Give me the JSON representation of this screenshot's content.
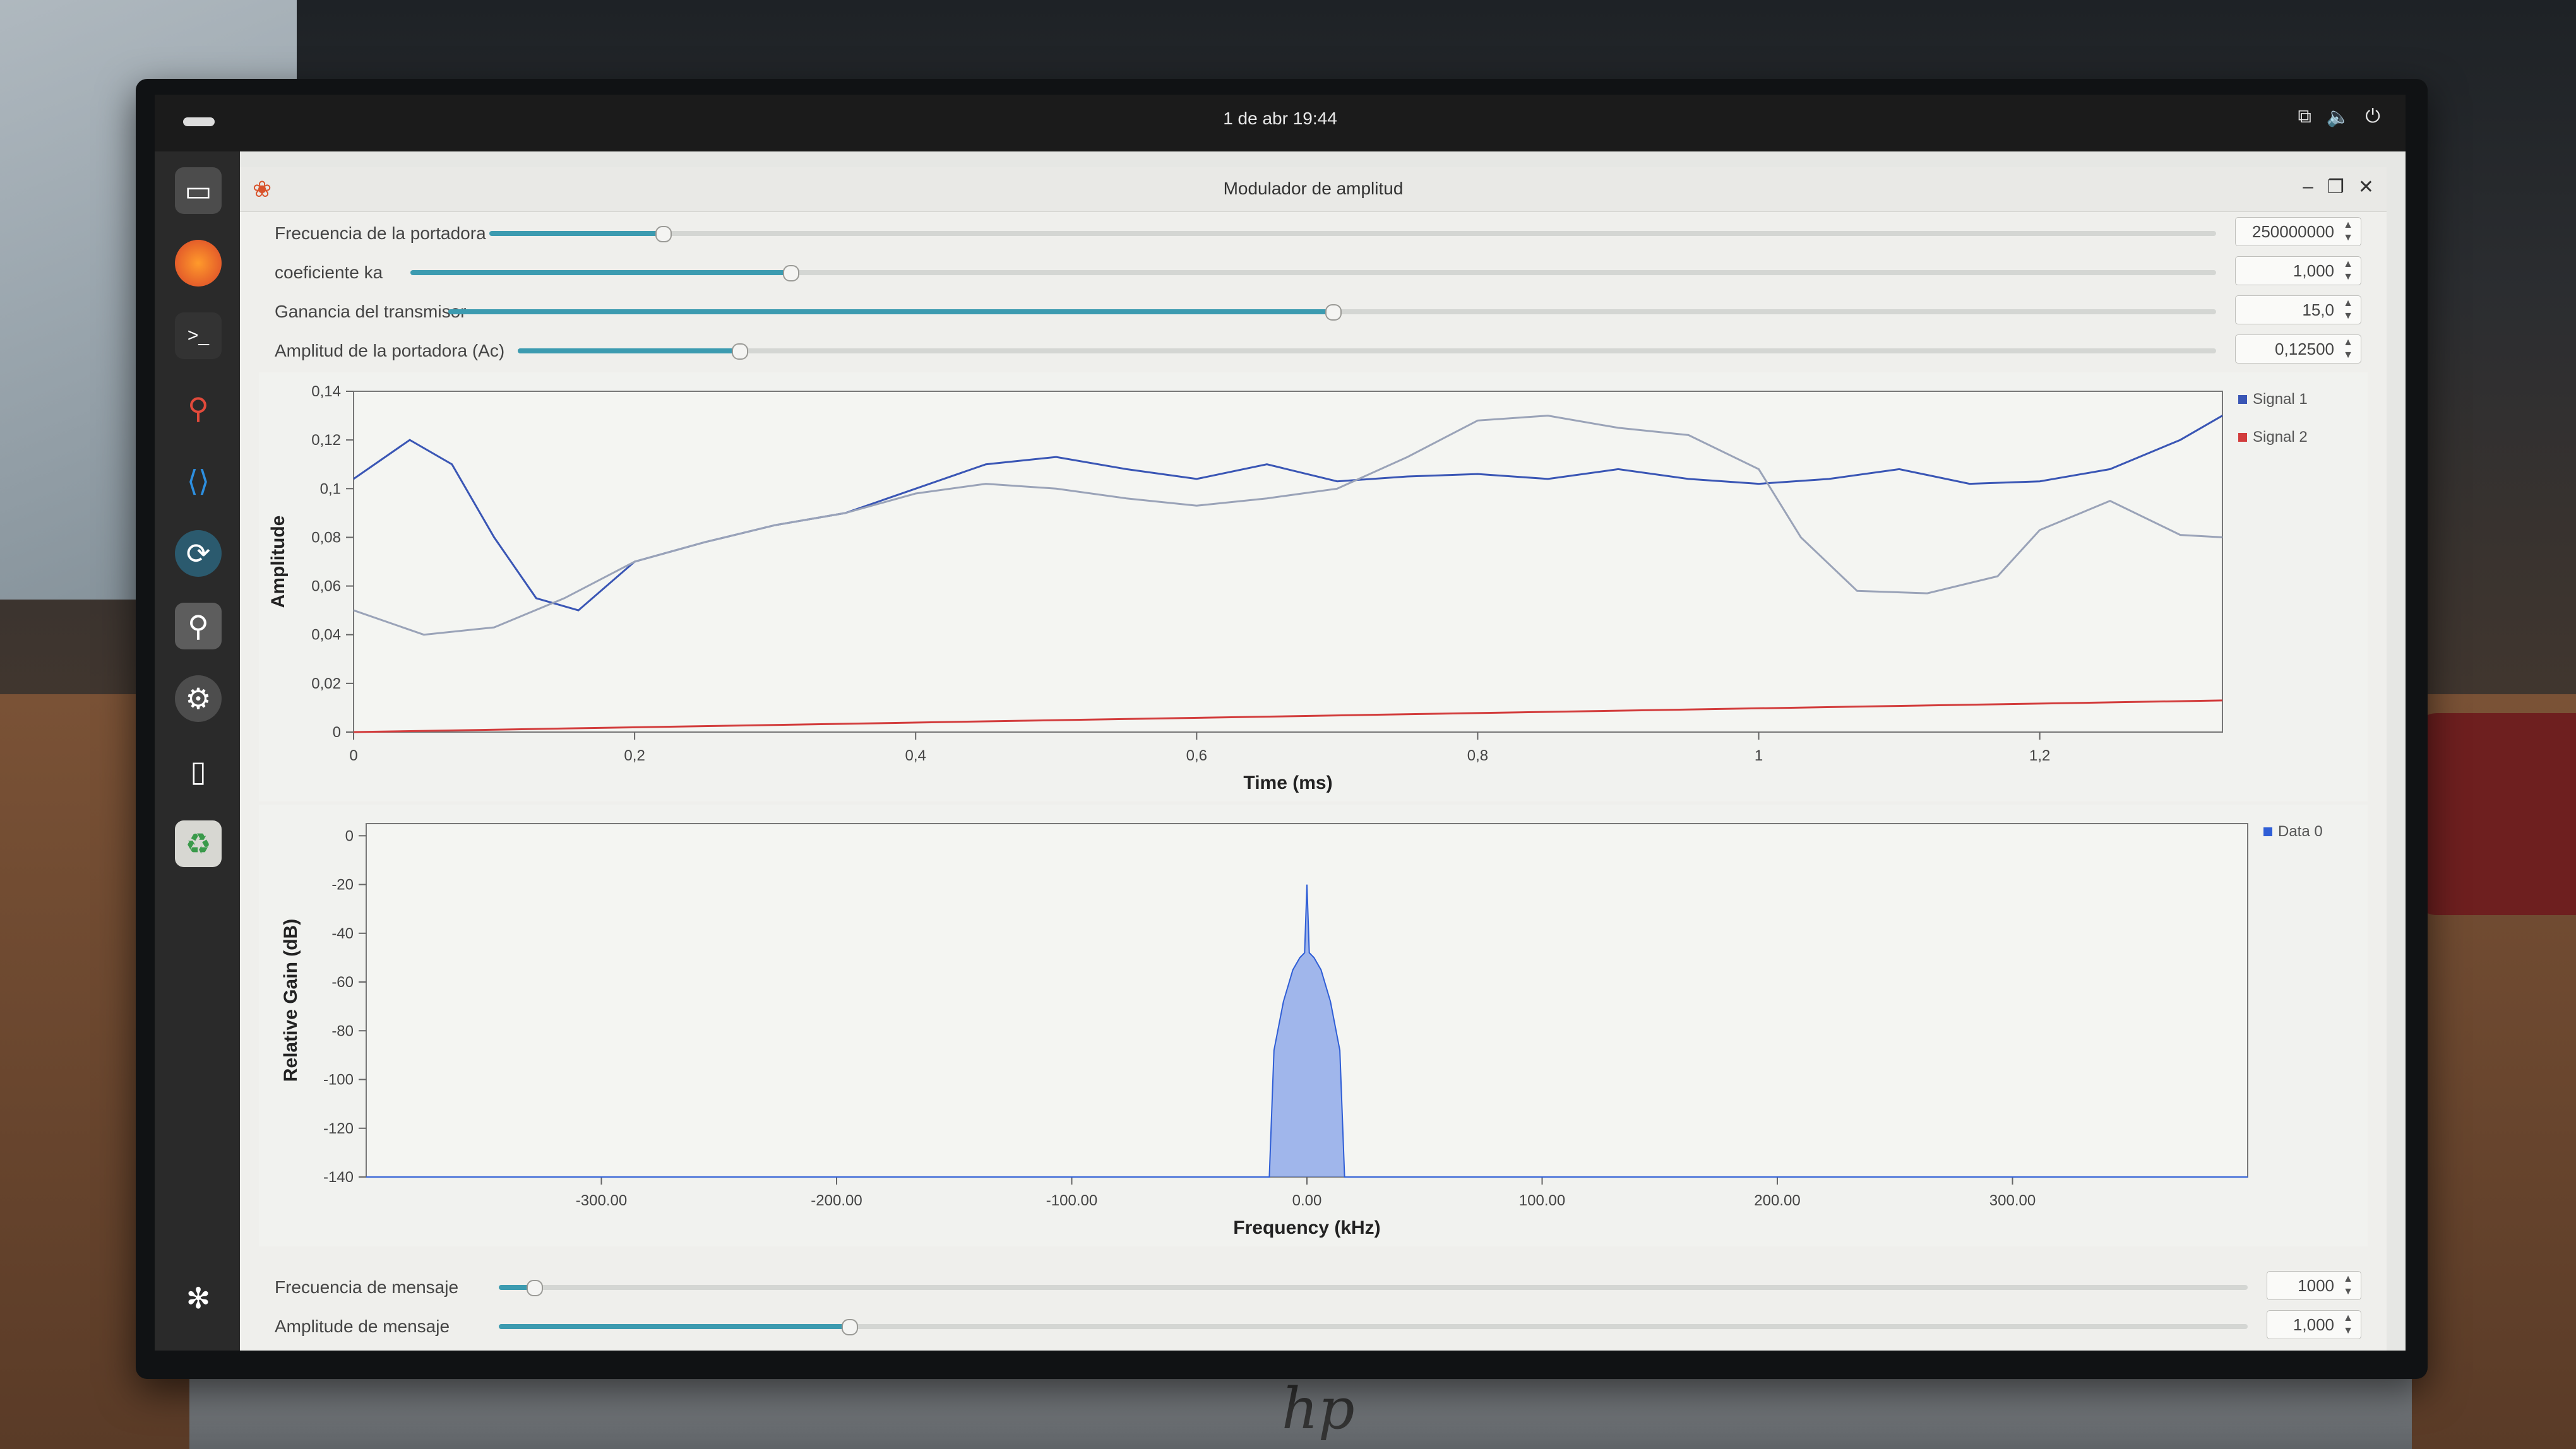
{
  "topbar": {
    "clock": "1 de abr  19:44",
    "tray_icons": [
      "network-icon",
      "volume-icon",
      "power-icon"
    ]
  },
  "window": {
    "title": "Modulador de amplitud"
  },
  "controls_top": [
    {
      "label": "Frecuencia de la portadora",
      "value": "250000000",
      "fraction": 0.1
    },
    {
      "label": "coeficiente ka",
      "value": "1,000",
      "fraction": 0.21
    },
    {
      "label": "Ganancia del transmisor",
      "value": "15,0",
      "fraction": 0.5
    },
    {
      "label": "Amplitud de la portadora (Ac)",
      "value": "0,12500",
      "fraction": 0.13
    }
  ],
  "controls_bottom": [
    {
      "label": "Frecuencia de mensaje",
      "value": "1000",
      "fraction": 0.02
    },
    {
      "label": "Amplitude de mensaje",
      "value": "1,000",
      "fraction": 0.2
    }
  ],
  "chart_data": [
    {
      "type": "line",
      "xlabel": "Time (ms)",
      "ylabel": "Amplitude",
      "xlim": [
        0,
        1.33
      ],
      "ylim": [
        0,
        0.14
      ],
      "x_ticks": [
        "0",
        "0,2",
        "0,4",
        "0,6",
        "0,8",
        "1",
        "1,2"
      ],
      "y_ticks": [
        "0",
        "0,02",
        "0,04",
        "0,06",
        "0,08",
        "0,1",
        "0,12",
        "0,14"
      ],
      "legend": "top-right",
      "series": [
        {
          "name": "Signal 1",
          "color": "#3a56b5",
          "x": [
            0,
            0.04,
            0.07,
            0.1,
            0.13,
            0.16,
            0.2,
            0.25,
            0.3,
            0.35,
            0.4,
            0.45,
            0.5,
            0.55,
            0.6,
            0.65,
            0.7,
            0.75,
            0.8,
            0.85,
            0.9,
            0.95,
            1.0,
            1.05,
            1.1,
            1.15,
            1.2,
            1.25,
            1.3,
            1.33
          ],
          "y": [
            0.104,
            0.12,
            0.11,
            0.08,
            0.055,
            0.05,
            0.07,
            0.078,
            0.085,
            0.09,
            0.1,
            0.11,
            0.113,
            0.108,
            0.104,
            0.11,
            0.103,
            0.105,
            0.106,
            0.104,
            0.108,
            0.104,
            0.102,
            0.104,
            0.108,
            0.102,
            0.103,
            0.108,
            0.12,
            0.13
          ]
        },
        {
          "name": "Signal 2",
          "color": "#d23c3c",
          "x": [
            0,
            1.33
          ],
          "y": [
            0,
            0.013
          ]
        },
        {
          "name": "",
          "color": "#9aa3b8",
          "x": [
            0,
            0.05,
            0.1,
            0.15,
            0.2,
            0.25,
            0.3,
            0.35,
            0.4,
            0.45,
            0.5,
            0.55,
            0.6,
            0.65,
            0.7,
            0.75,
            0.8,
            0.85,
            0.9,
            0.95,
            1.0,
            1.03,
            1.07,
            1.12,
            1.17,
            1.2,
            1.25,
            1.3,
            1.33
          ],
          "y": [
            0.05,
            0.04,
            0.043,
            0.055,
            0.07,
            0.078,
            0.085,
            0.09,
            0.098,
            0.102,
            0.1,
            0.096,
            0.093,
            0.096,
            0.1,
            0.113,
            0.128,
            0.13,
            0.125,
            0.122,
            0.108,
            0.08,
            0.058,
            0.057,
            0.064,
            0.083,
            0.095,
            0.081,
            0.08
          ]
        }
      ]
    },
    {
      "type": "line",
      "xlabel": "Frequency (kHz)",
      "ylabel": "Relative Gain (dB)",
      "xlim": [
        -400,
        400
      ],
      "ylim": [
        -140,
        5
      ],
      "x_ticks": [
        "-300.00",
        "-200.00",
        "-100.00",
        "0.00",
        "100.00",
        "200.00",
        "300.00"
      ],
      "y_ticks": [
        "0",
        "-20",
        "-40",
        "-60",
        "-80",
        "-100",
        "-120",
        "-140"
      ],
      "legend": "top-right",
      "series": [
        {
          "name": "Data 0",
          "color": "#2f5ed6",
          "x": [
            -400,
            -40,
            -16,
            -14,
            -10,
            -6,
            -3,
            -1,
            0,
            1,
            3,
            6,
            10,
            14,
            16,
            40,
            400
          ],
          "y": [
            -140,
            -140,
            -140,
            -88,
            -68,
            -55,
            -50,
            -48,
            -20,
            -48,
            -50,
            -55,
            -68,
            -88,
            -140,
            -140,
            -140
          ]
        }
      ]
    }
  ]
}
